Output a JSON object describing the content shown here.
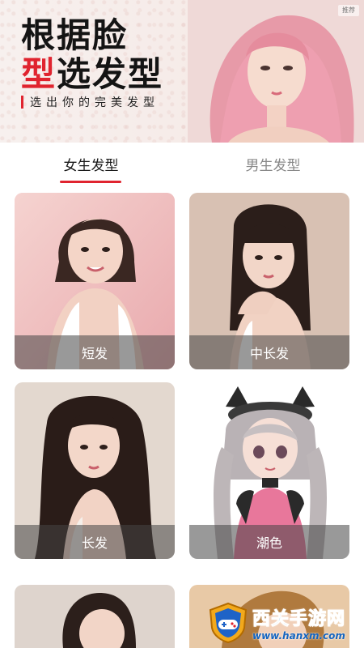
{
  "banner": {
    "title_line1": "根据脸",
    "title_line2_accent": "型",
    "title_line2_rest": "选发型",
    "tagline": "选出你的完美发型",
    "badge": "推荐",
    "accent_color": "#e0242f"
  },
  "tabs": [
    {
      "label": "女生发型",
      "active": true
    },
    {
      "label": "男生发型",
      "active": false
    }
  ],
  "cards": [
    {
      "label": "短发",
      "icon": "short-hair-portrait"
    },
    {
      "label": "中长发",
      "icon": "medium-hair-portrait"
    },
    {
      "label": "长发",
      "icon": "long-hair-portrait"
    },
    {
      "label": "潮色",
      "icon": "trendy-color-anime-portrait"
    },
    {
      "label": "",
      "icon": "portrait-partial"
    },
    {
      "label": "",
      "icon": "portrait-partial"
    }
  ],
  "watermark": {
    "name": "西关手游网",
    "url": "www.hanxm.com"
  }
}
